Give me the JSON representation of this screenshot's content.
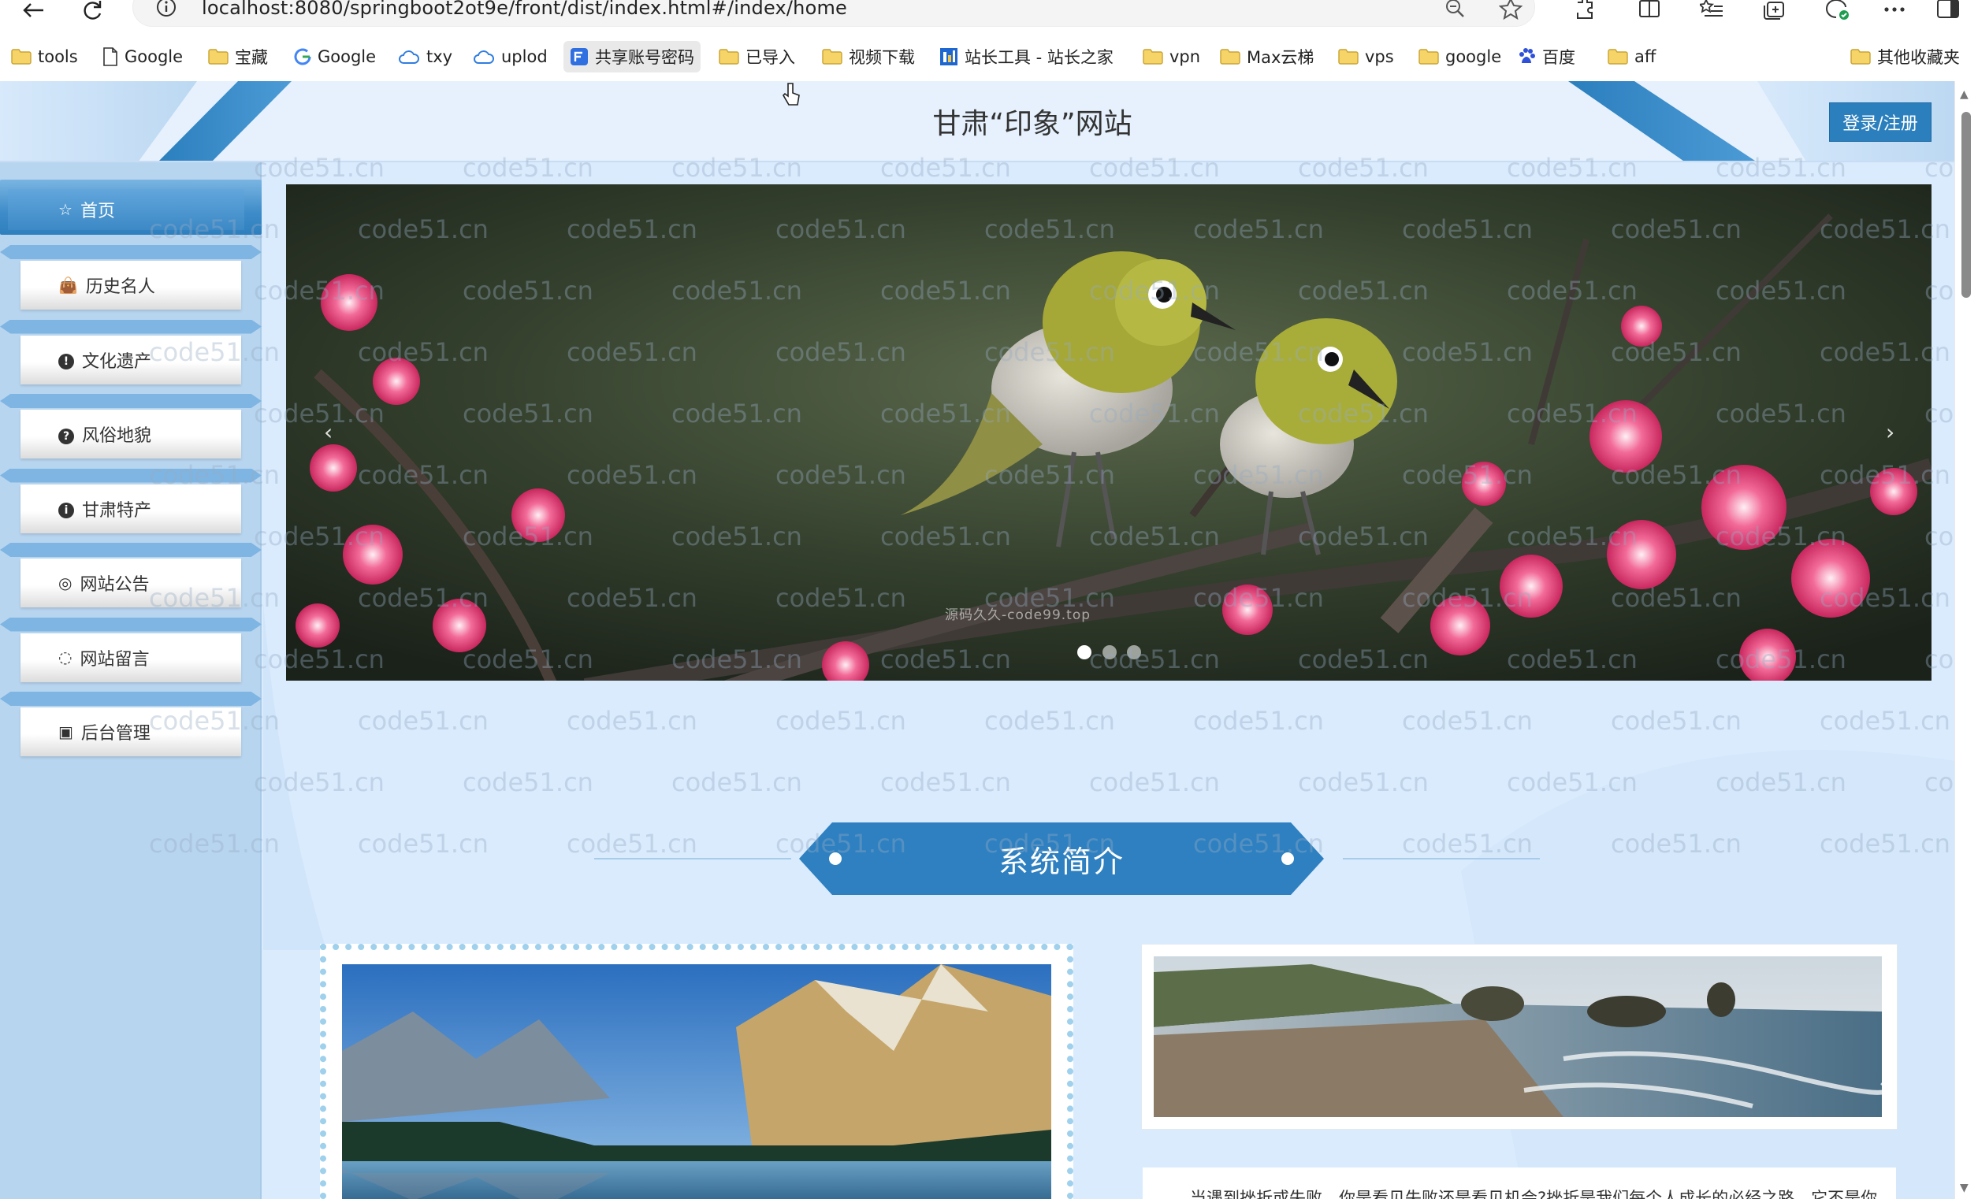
{
  "browser": {
    "url": "localhost:8080/springboot2ot9e/front/dist/index.html#/index/home",
    "bookmarks": [
      {
        "label": "tools",
        "icon": "folder-icon"
      },
      {
        "label": "Google",
        "icon": "page-icon"
      },
      {
        "label": "宝藏",
        "icon": "folder-icon"
      },
      {
        "label": "Google",
        "icon": "google-icon"
      },
      {
        "label": "txy",
        "icon": "cloud-icon"
      },
      {
        "label": "uplod",
        "icon": "cloud-icon"
      },
      {
        "label": "共享账号密码",
        "icon": "share-icon"
      },
      {
        "label": "已导入",
        "icon": "folder-icon"
      },
      {
        "label": "视频下载",
        "icon": "folder-icon"
      },
      {
        "label": "站长工具 - 站长之家",
        "icon": "tools-site-icon"
      },
      {
        "label": "vpn",
        "icon": "folder-icon"
      },
      {
        "label": "Max云梯",
        "icon": "folder-icon"
      },
      {
        "label": "vps",
        "icon": "folder-icon"
      },
      {
        "label": "google",
        "icon": "folder-icon"
      },
      {
        "label": "百度",
        "icon": "baidu-icon"
      },
      {
        "label": "aff",
        "icon": "folder-icon"
      },
      {
        "label": "其他收藏夹",
        "icon": "folder-icon"
      }
    ]
  },
  "header": {
    "title": "甘肃“印象”网站",
    "login_label": "登录/注册"
  },
  "sidebar": {
    "items": [
      {
        "label": "首页",
        "icon": "star-icon"
      },
      {
        "label": "历史名人",
        "icon": "bag-icon"
      },
      {
        "label": "文化遗产",
        "icon": "exclamation-icon"
      },
      {
        "label": "风俗地貌",
        "icon": "question-icon"
      },
      {
        "label": "甘肃特产",
        "icon": "info-icon"
      },
      {
        "label": "网站公告",
        "icon": "circle-icon"
      },
      {
        "label": "网站留言",
        "icon": "chat-icon"
      },
      {
        "label": "后台管理",
        "icon": "briefcase-icon"
      }
    ]
  },
  "banner": {
    "caption": "源码久久-code99.top",
    "slide_count": 3,
    "active_slide": 1
  },
  "section": {
    "title": "系统简介"
  },
  "intro": {
    "text": "当遇到挫折或失败，你是看见失败还是看见机会?挫折是我们每个人成长的必经之路，它不是你想有就有，想没有就没有的。有句名言说的好，如果你想一生摆脱苦难，你就得是神或者是死尸。这句话形象地说明了挫折是伴随着人生的，是谁都逃不掉的。人生在世，从古到今，"
  },
  "watermark": "code51.cn",
  "colors": {
    "primary": "#2b7fbd",
    "sidebar_bg": "#b8d5f0",
    "content_bg": "#d9ebfd"
  }
}
